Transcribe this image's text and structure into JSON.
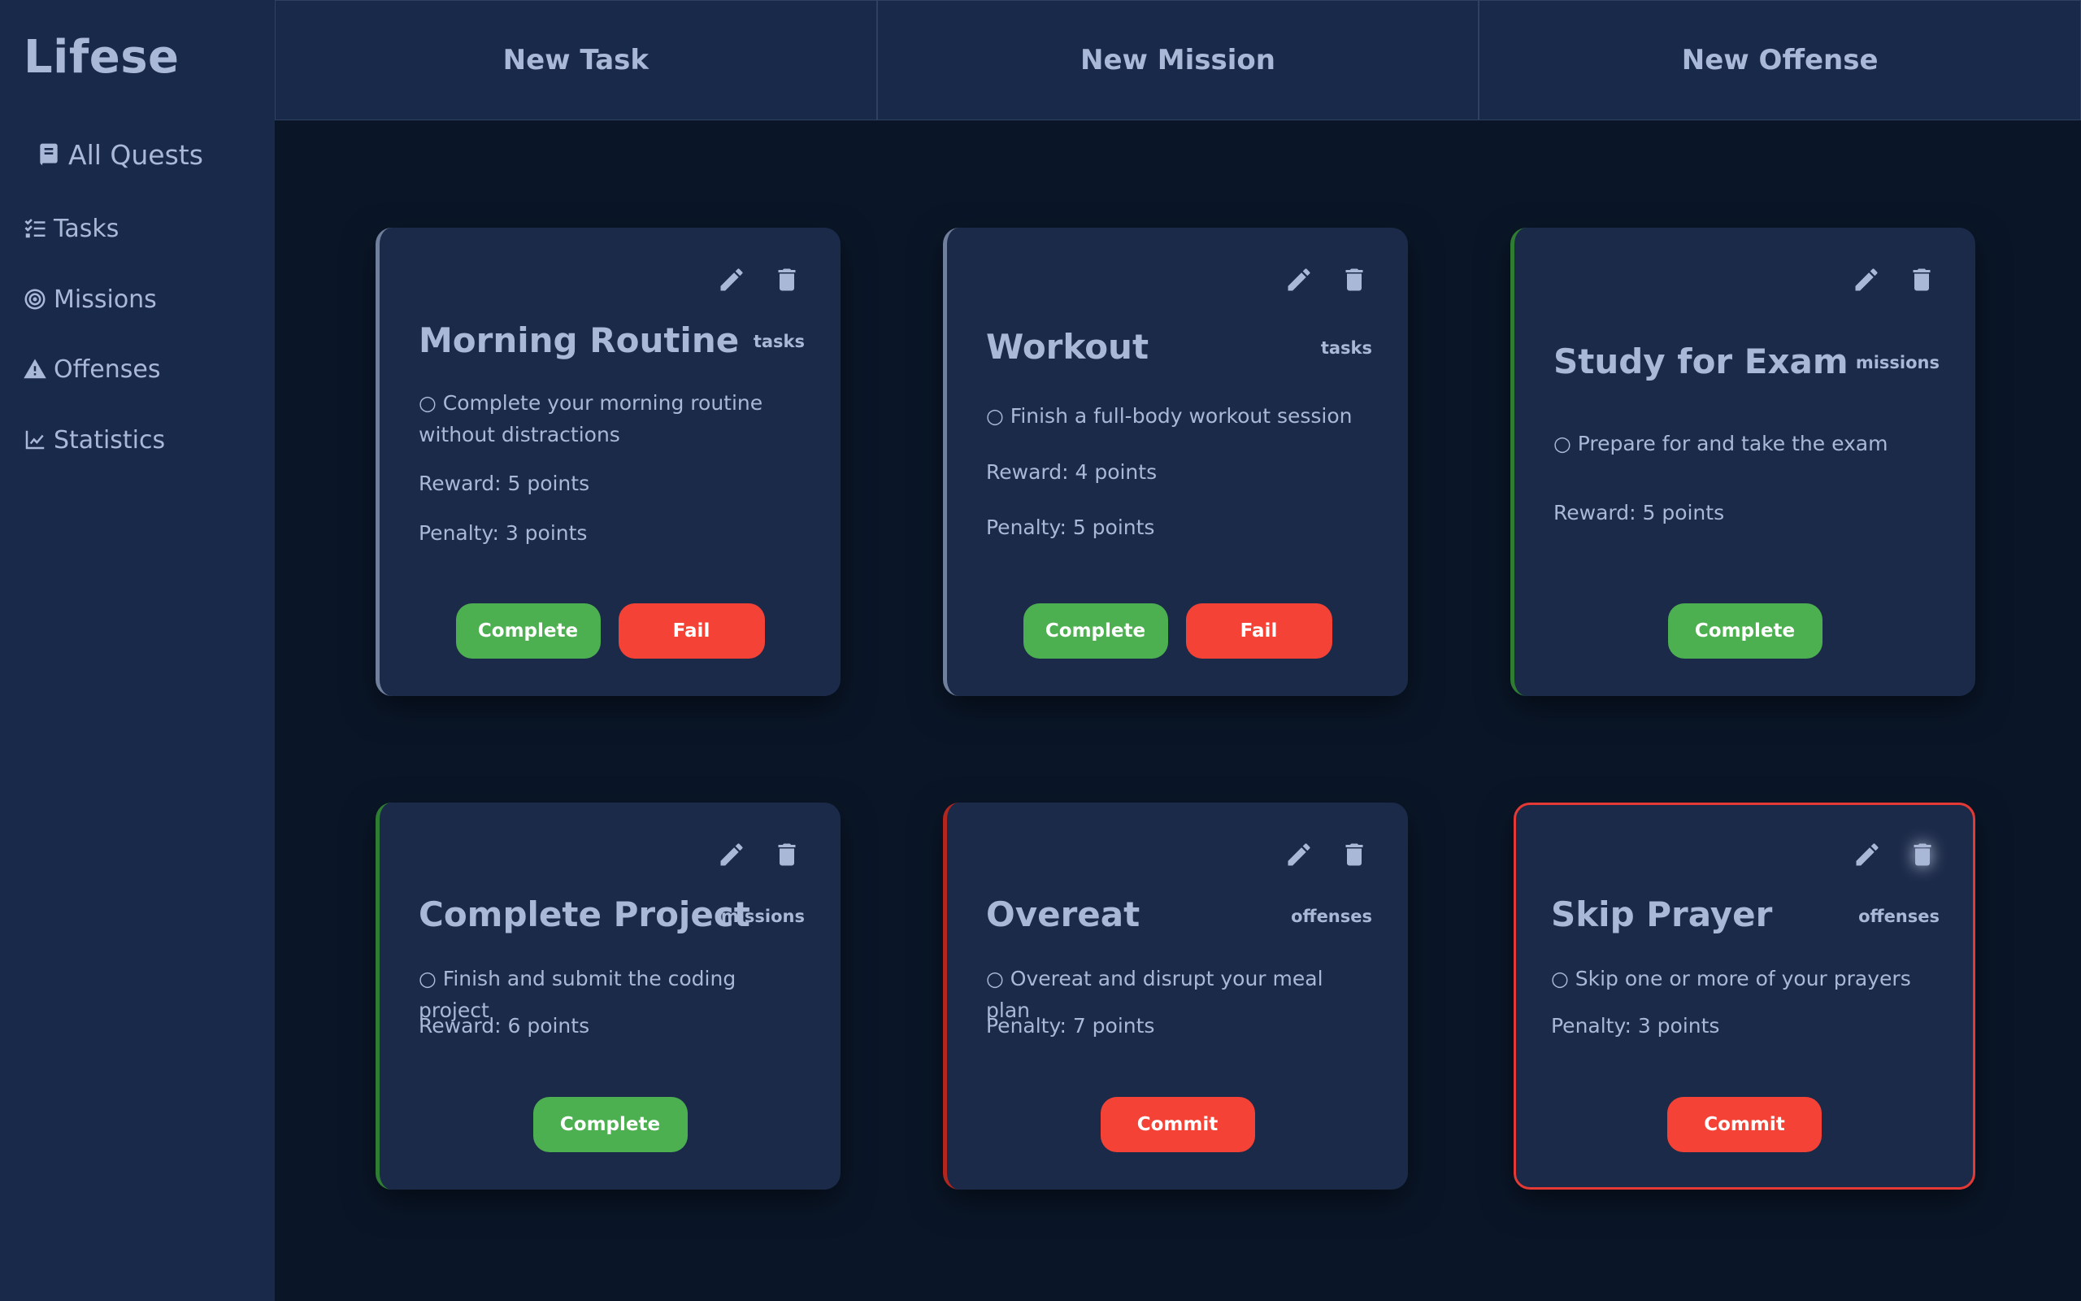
{
  "app": {
    "brand": "Lifese"
  },
  "sidebar": {
    "items": [
      {
        "label": "All Quests",
        "icon": "book-icon"
      },
      {
        "label": "Tasks",
        "icon": "checklist-icon"
      },
      {
        "label": "Missions",
        "icon": "target-icon"
      },
      {
        "label": "Offenses",
        "icon": "warning-icon"
      },
      {
        "label": "Statistics",
        "icon": "chart-line-icon"
      }
    ]
  },
  "topbar": {
    "new_task": "New Task",
    "new_mission": "New Mission",
    "new_offense": "New Offense"
  },
  "colors": {
    "background": "#0a1628",
    "panel": "#19294a",
    "card": "#1b2a48",
    "text": "#a9b8d6",
    "complete": "#4caf50",
    "fail": "#f44336",
    "mission_accent": "#2e7d32",
    "offense_accent": "#b3261e"
  },
  "quests": [
    {
      "title": "Morning Routine",
      "type": "tasks",
      "description": "○ Complete your morning routine without distractions",
      "reward": "Reward: 5 points",
      "penalty": "Penalty: 3 points",
      "primary_label": "Complete",
      "secondary_label": "Fail"
    },
    {
      "title": "Workout",
      "type": "tasks",
      "description": "○ Finish a full-body workout session",
      "reward": "Reward: 4 points",
      "penalty": "Penalty: 5 points",
      "primary_label": "Complete",
      "secondary_label": "Fail"
    },
    {
      "title": "Study for Exam",
      "type": "missions",
      "description": "○ Prepare for and take the exam",
      "reward": "Reward: 5 points",
      "primary_label": "Complete"
    },
    {
      "title": "Complete Project",
      "type": "missions",
      "description": "○ Finish and submit the coding project",
      "reward": "Reward: 6 points",
      "primary_label": "Complete"
    },
    {
      "title": "Overeat",
      "type": "offenses",
      "description": "○ Overeat and disrupt your meal plan",
      "penalty": "Penalty: 7 points",
      "primary_label": "Commit"
    },
    {
      "title": "Skip Prayer",
      "type": "offenses",
      "description": "○ Skip one or more of your prayers",
      "penalty": "Penalty: 3 points",
      "primary_label": "Commit"
    }
  ]
}
